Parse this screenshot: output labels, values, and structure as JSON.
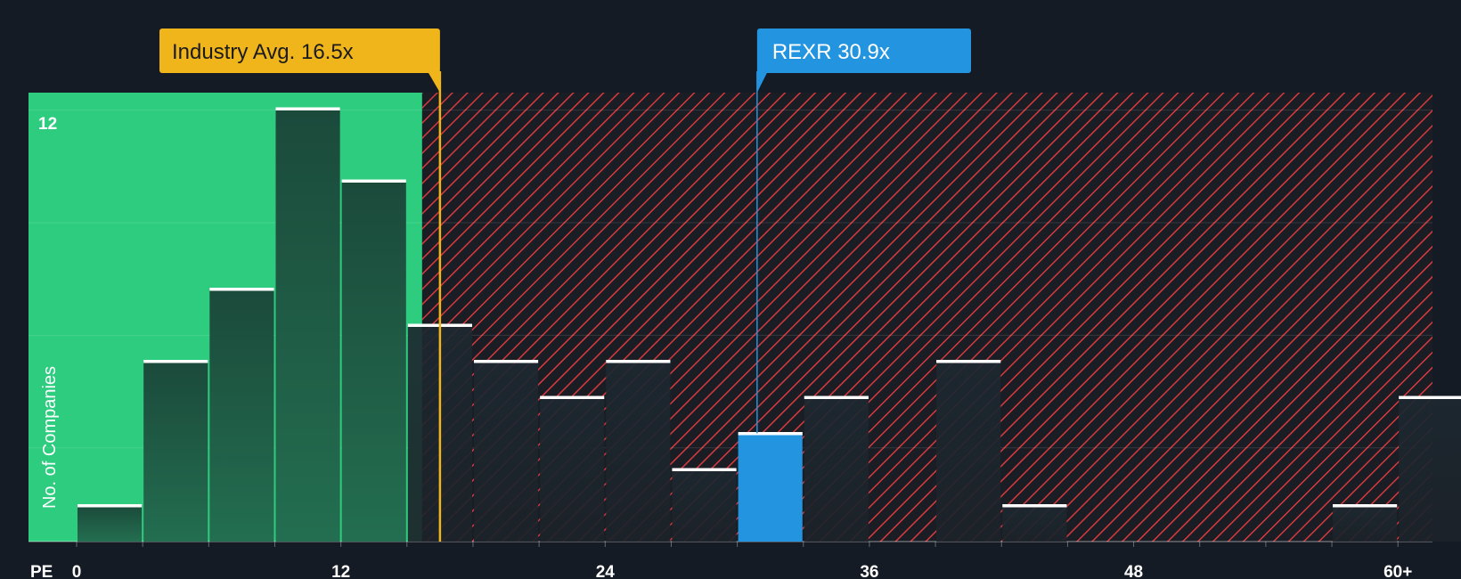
{
  "chart_data": {
    "type": "bar",
    "bin_width": 3,
    "bin_starts": [
      0,
      3,
      6,
      9,
      12,
      15,
      18,
      21,
      24,
      27,
      30,
      33,
      36,
      39,
      42,
      45,
      48,
      51,
      54,
      57,
      60
    ],
    "values": [
      1,
      5,
      7,
      12,
      10,
      6,
      5,
      4,
      5,
      2,
      3,
      4,
      0,
      5,
      1,
      0,
      0,
      0,
      0,
      1,
      4
    ],
    "highlight_bin_start": 30,
    "xlabel": "PE",
    "ylabel": "No. of Companies",
    "x_ticks": [
      "0",
      "12",
      "24",
      "36",
      "48",
      "60+"
    ],
    "x_tick_values": [
      0,
      12,
      24,
      36,
      48,
      60
    ],
    "y_ticks": [
      "12"
    ],
    "y_tick_values": [
      12
    ],
    "xlim": [
      0,
      62
    ],
    "ylim": [
      0,
      12.4
    ],
    "grid": true,
    "industry_avg": {
      "label": "Industry Avg. 16.5x",
      "value": 16.5
    },
    "company": {
      "label": "REXR 30.9x",
      "value": 30.9
    }
  },
  "colors": {
    "background": "#151b24",
    "good_zone": "#2ecc7f",
    "bar_dark": "#1e3f35",
    "bad_zone_stripe": "#d63a3f",
    "highlight": "#2394e0",
    "industry_label": "#f0b51b",
    "bar_top": "#ffffff"
  }
}
